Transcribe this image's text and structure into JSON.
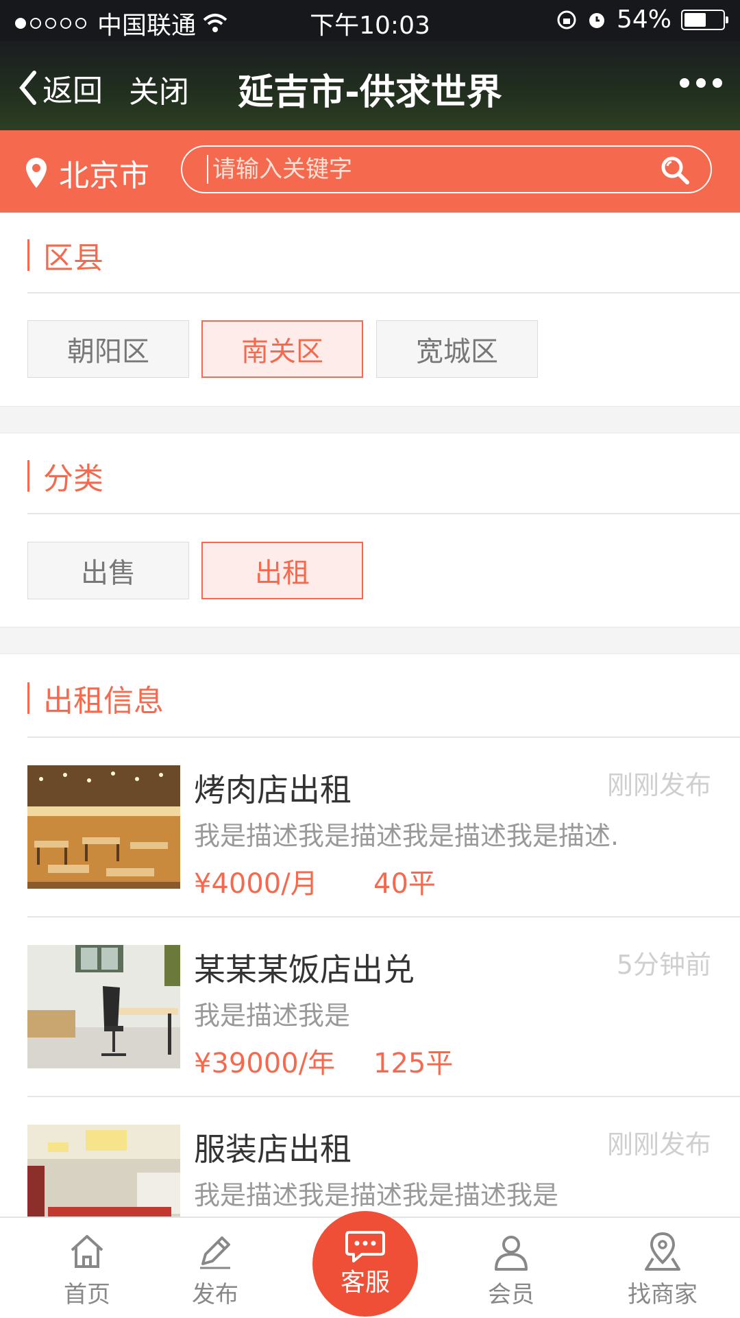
{
  "status": {
    "carrier": "中国联通",
    "time": "下午10:03",
    "battery": "54%",
    "signal_dots": [
      1,
      0,
      0,
      0,
      0
    ]
  },
  "nav": {
    "back_label": "返回",
    "close_label": "关闭",
    "title": "延吉市-供求世界"
  },
  "search": {
    "city": "北京市",
    "placeholder": "请输入关键字"
  },
  "district": {
    "title": "区县",
    "options": [
      "朝阳区",
      "南关区",
      "宽城区"
    ],
    "active": "南关区"
  },
  "category": {
    "title": "分类",
    "options": [
      "出售",
      "出租"
    ],
    "active": "出租"
  },
  "listing": {
    "title": "出租信息",
    "items": [
      {
        "title": "烤肉店出租",
        "time": "刚刚发布",
        "desc": "我是描述我是描述我是描述我是描述.",
        "price": "¥4000/月",
        "area": "40平",
        "thumb": "restaurant-hall"
      },
      {
        "title": "某某某饭店出兑",
        "time": "5分钟前",
        "desc": "我是描述我是",
        "price": "¥39000/年",
        "area": "125平",
        "thumb": "office-room"
      },
      {
        "title": "服装店出租",
        "time": "刚刚发布",
        "desc": "我是描述我是描述我是描述我是",
        "price": "",
        "area": "",
        "thumb": "store-interior"
      }
    ]
  },
  "tabbar": {
    "items": [
      {
        "label": "首页",
        "icon": "home-icon"
      },
      {
        "label": "发布",
        "icon": "pencil-icon"
      },
      {
        "label": "客服",
        "icon": "chat-icon"
      },
      {
        "label": "会员",
        "icon": "user-icon"
      },
      {
        "label": "找商家",
        "icon": "location-icon"
      }
    ]
  },
  "colors": {
    "accent": "#f56a4e",
    "center_button": "#ee4f36",
    "status_bg": "#17181c"
  }
}
